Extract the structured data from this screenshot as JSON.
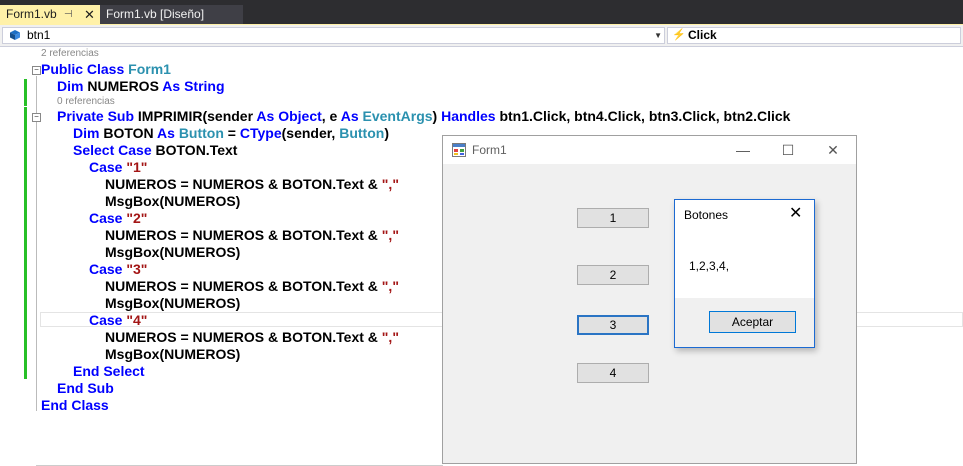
{
  "tabs": [
    {
      "label": "Form1.vb"
    },
    {
      "label": "Form1.vb [Diseño]"
    }
  ],
  "nav": {
    "left_combo": "btn1",
    "right_combo": "Click"
  },
  "code": {
    "ref_class": "2 referencias",
    "ref_sub": "0 referencias",
    "l_class_kw": "Public Class ",
    "l_class_name": "Form1",
    "l_dim_kw": "Dim ",
    "l_dim_name": "NUMEROS ",
    "l_dim_as": "As String",
    "l_sub_kw": "Private Sub ",
    "l_sub_name": "IMPRIMIR(sender ",
    "l_sub_as1": "As Object",
    "l_sub_mid": ", e ",
    "l_sub_as2": "As ",
    "l_sub_type": "EventArgs",
    "l_sub_close": ") ",
    "l_sub_handles": "Handles ",
    "l_sub_events": "btn1.Click, btn4.Click, btn3.Click, btn2.Click",
    "l_boton_kw": "Dim ",
    "l_boton_name": "BOTON ",
    "l_boton_as": "As ",
    "l_boton_type": "Button",
    "l_boton_eq": " = ",
    "l_boton_ctype": "CType",
    "l_boton_arg": "(sender, ",
    "l_boton_type2": "Button",
    "l_boton_end": ")",
    "l_select_kw": "Select Case ",
    "l_select_expr": "BOTON.Text",
    "case_kw": "Case ",
    "cases": [
      "\"1\"",
      "\"2\"",
      "\"3\"",
      "\"4\""
    ],
    "l_concat": "NUMEROS = NUMEROS & BOTON.Text & ",
    "l_concat_str": "\",\"",
    "l_msgbox": "MsgBox(NUMEROS)",
    "l_end_select": "End Select",
    "l_end_sub": "End Sub",
    "l_end_class": "End Class"
  },
  "form1": {
    "title": "Form1",
    "buttons": [
      "1",
      "2",
      "3",
      "4"
    ],
    "minimize": "—",
    "maximize": "☐",
    "close": "✕"
  },
  "msgbox": {
    "title": "Botones",
    "text": "1,2,3,4,",
    "ok": "Aceptar",
    "close": "✕"
  },
  "colors": {
    "keyword": "#0000ff",
    "type": "#2b91af",
    "string": "#a31515",
    "active_tab": "#fff1a8",
    "change_bar": "#28c028"
  }
}
